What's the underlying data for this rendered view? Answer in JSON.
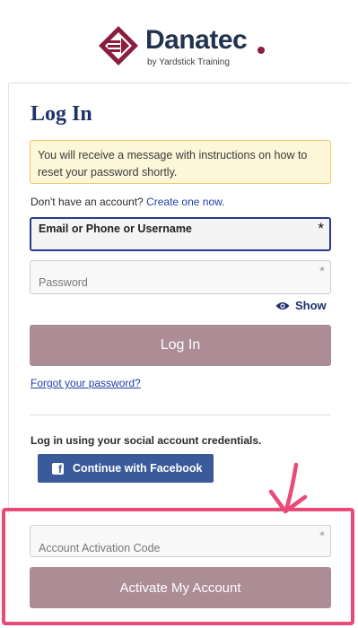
{
  "brand": {
    "name": "Danatec",
    "tagline": "by Yardstick Training",
    "colors": {
      "navy": "#23324f",
      "maroon": "#8b1e3f"
    }
  },
  "login": {
    "title": "Log In",
    "notice": "You will receive a message with instructions on how to reset your password shortly.",
    "no_account_text": "Don't have an account?",
    "create_link": "Create one now.",
    "email_label": "Email or Phone or Username",
    "required_mark": "*",
    "password_placeholder": "Password",
    "show_label": "Show",
    "login_button": "Log In",
    "forgot_link": "Forgot your password?"
  },
  "social": {
    "prompt": "Log in using your social account credentials.",
    "facebook_button": "Continue with Facebook",
    "facebook_icon": "f"
  },
  "activation": {
    "code_placeholder": "Account Activation Code",
    "activate_button": "Activate My Account",
    "highlight_color": "#e94a78"
  }
}
